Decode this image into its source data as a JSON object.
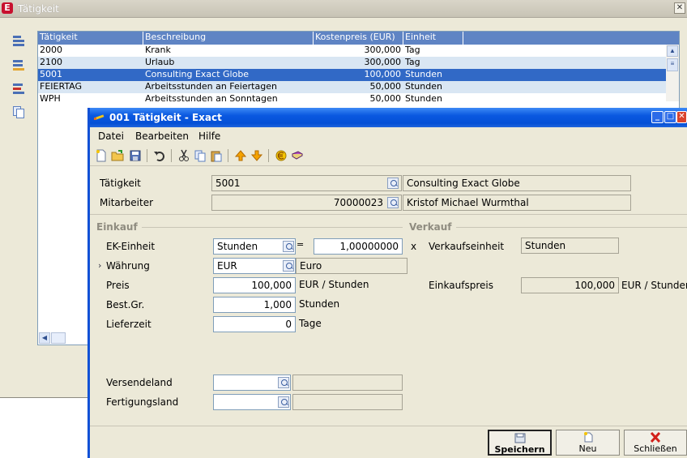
{
  "bg_window": {
    "title": "Tätigkeit",
    "grid": {
      "columns": [
        "Tätigkeit",
        "Beschreibung",
        "Kostenpreis (EUR)",
        "Einheit"
      ],
      "rows": [
        {
          "code": "2000",
          "desc": "Krank",
          "price": "300,000",
          "unit": "Tag"
        },
        {
          "code": "2100",
          "desc": "Urlaub",
          "price": "300,000",
          "unit": "Tag"
        },
        {
          "code": "5001",
          "desc": "Consulting Exact Globe",
          "price": "100,000",
          "unit": "Stunden"
        },
        {
          "code": "FEIERTAG",
          "desc": "Arbeitsstunden an Feiertagen",
          "price": "50,000",
          "unit": "Stunden"
        },
        {
          "code": "WPH",
          "desc": "Arbeitsstunden an Sonntagen",
          "price": "50,000",
          "unit": "Stunden"
        }
      ],
      "selected_row": 2
    }
  },
  "dialog": {
    "title": "001 Tätigkeit - Exact",
    "menu": [
      "Datei",
      "Bearbeiten",
      "Hilfe"
    ],
    "header": {
      "taetigkeit_label": "Tätigkeit",
      "taetigkeit_value": "5001",
      "taetigkeit_desc": "Consulting Exact Globe",
      "mitarbeiter_label": "Mitarbeiter",
      "mitarbeiter_value": "70000023",
      "mitarbeiter_name": "Kristof Michael Wurmthal"
    },
    "einkauf": {
      "title": "Einkauf",
      "ek_einheit_label": "EK-Einheit",
      "ek_einheit_value": "Stunden",
      "equals": "=",
      "factor_value": "1,00000000",
      "times": "x",
      "waehrung_marker": "›",
      "waehrung_label": "Währung",
      "waehrung_value": "EUR",
      "waehrung_desc": "Euro",
      "preis_label": "Preis",
      "preis_value": "100,000",
      "preis_unit": "EUR / Stunden",
      "bestgr_label": "Best.Gr.",
      "bestgr_value": "1,000",
      "bestgr_unit": "Stunden",
      "lieferzeit_label": "Lieferzeit",
      "lieferzeit_value": "0",
      "lieferzeit_unit": "Tage",
      "versendeland_label": "Versendeland",
      "versendeland_value": "",
      "fertigungsland_label": "Fertigungsland",
      "fertigungsland_value": ""
    },
    "verkauf": {
      "title": "Verkauf",
      "verkaufseinheit_label": "Verkaufseinheit",
      "verkaufseinheit_value": "Stunden",
      "einkaufspreis_label": "Einkaufspreis",
      "einkaufspreis_value": "100,000",
      "einkaufspreis_unit": "EUR / Stunder"
    },
    "buttons": {
      "save": "Speichern",
      "new": "Neu",
      "close": "Schließen"
    }
  },
  "colors": {
    "selection": "#3169c6",
    "grid_header": "#5f84c4",
    "alt_row": "#d9e6f3",
    "titlebar": "#0a58e0"
  }
}
